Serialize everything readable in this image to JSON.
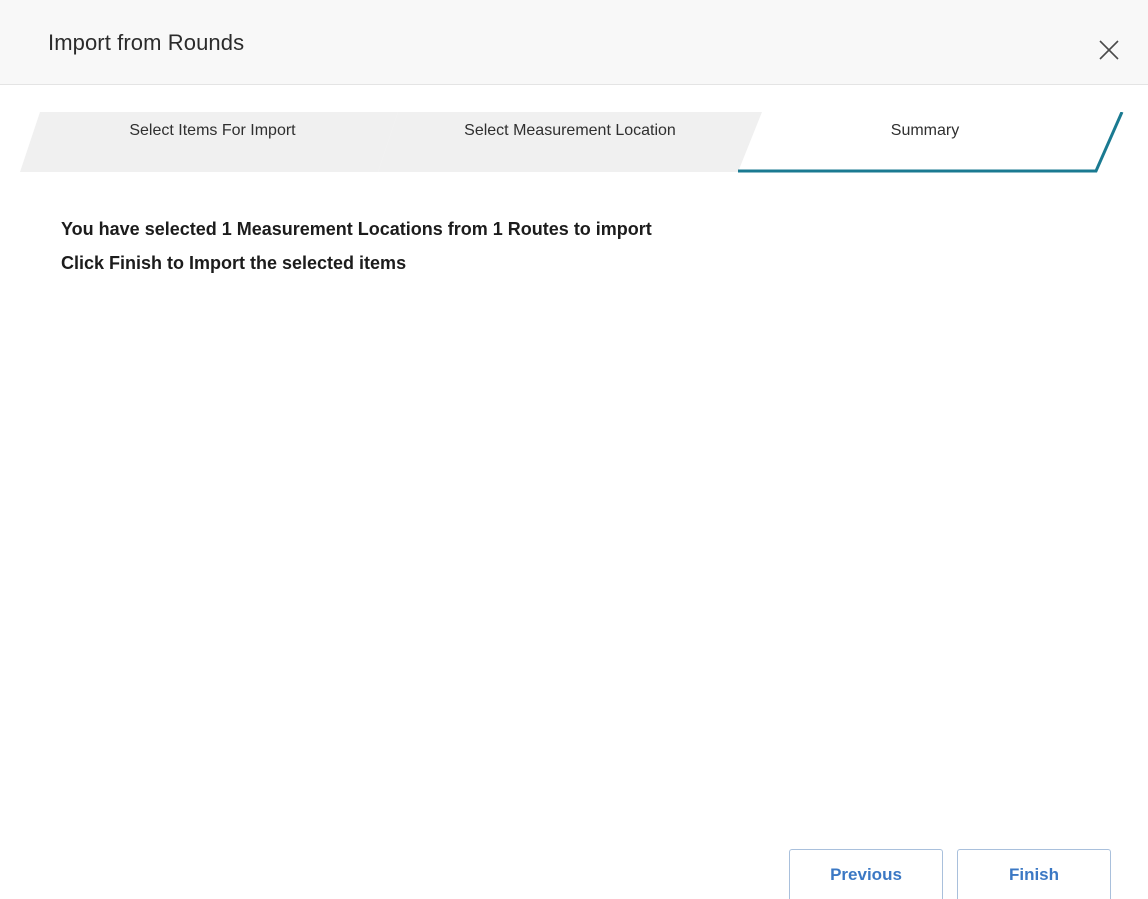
{
  "dialog": {
    "title": "Import from Rounds"
  },
  "steps": [
    {
      "label": "Select Items For Import",
      "active": false
    },
    {
      "label": "Select Measurement Location",
      "active": false
    },
    {
      "label": "Summary",
      "active": true
    }
  ],
  "summary": {
    "line1": "You have selected 1 Measurement Locations from 1 Routes to import",
    "line2": "Click Finish to Import the selected items"
  },
  "footer": {
    "previous_label": "Previous",
    "finish_label": "Finish"
  },
  "colors": {
    "accent": "#1a7a91",
    "button_text": "#3b78c4",
    "inactive_step": "#f0f0f0"
  },
  "icons": {
    "close": "close-icon"
  }
}
